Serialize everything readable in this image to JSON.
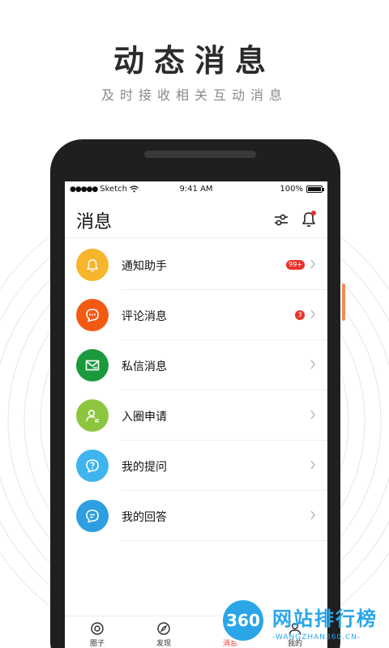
{
  "promo": {
    "title": "动态消息",
    "subtitle": "及时接收相关互动消息"
  },
  "status_bar": {
    "carrier": "Sketch",
    "time": "9:41 AM",
    "battery": "100%"
  },
  "nav": {
    "title": "消息",
    "filter_icon": "filter-sliders-icon",
    "bell_icon": "bell-icon",
    "bell_dot_color": "#e8332d"
  },
  "messages": [
    {
      "label": "通知助手",
      "badge": "99+",
      "icon": "bell-icon",
      "color": "#f7b52c"
    },
    {
      "label": "评论消息",
      "badge": "3",
      "icon": "comment-icon",
      "color": "#f25a14"
    },
    {
      "label": "私信消息",
      "badge": "",
      "icon": "envelope-icon",
      "color": "#1a9a3c"
    },
    {
      "label": "入圈申请",
      "badge": "",
      "icon": "user-add-icon",
      "color": "#8cc63f"
    },
    {
      "label": "我的提问",
      "badge": "",
      "icon": "question-icon",
      "color": "#3fb4ee"
    },
    {
      "label": "我的回答",
      "badge": "",
      "icon": "answer-icon",
      "color": "#2d9fe0"
    }
  ],
  "tabs": [
    {
      "label": "圈子",
      "icon": "circle-icon"
    },
    {
      "label": "发现",
      "icon": "compass-icon"
    },
    {
      "label": "消息",
      "icon": "message-icon"
    },
    {
      "label": "我的",
      "icon": "user-icon"
    }
  ],
  "watermark": {
    "logo_text": "360",
    "title": "网站排行榜",
    "subtitle": "-WANGZHAN360.CN-"
  }
}
